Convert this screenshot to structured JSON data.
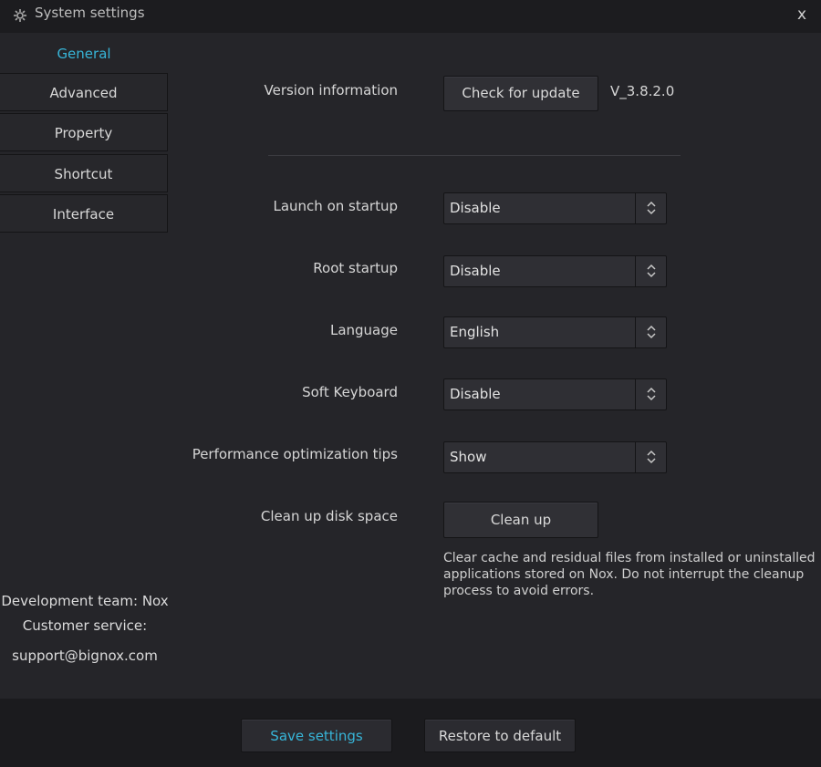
{
  "window": {
    "title": "System settings",
    "close_label": "x"
  },
  "sidebar": {
    "items": [
      {
        "label": "General",
        "active": true
      },
      {
        "label": "Advanced"
      },
      {
        "label": "Property"
      },
      {
        "label": "Shortcut"
      },
      {
        "label": "Interface"
      }
    ],
    "dev_team": "Development team: Nox",
    "customer_service": "Customer service:",
    "support_email": "support@bignox.com"
  },
  "general": {
    "version_label": "Version information",
    "check_update_label": "Check for update",
    "version_value": "V_3.8.2.0",
    "launch_label": "Launch on startup",
    "launch_value": "Disable",
    "root_label": "Root startup",
    "root_value": "Disable",
    "language_label": "Language",
    "language_value": "English",
    "keyboard_label": "Soft Keyboard",
    "keyboard_value": "Disable",
    "perf_label": "Performance optimization tips",
    "perf_value": "Show",
    "cleanup_label": "Clean up disk space",
    "cleanup_button": "Clean up",
    "cleanup_desc": "Clear cache and residual files from installed or uninstalled applications stored on Nox. Do not interrupt the cleanup process to avoid errors."
  },
  "footer": {
    "save_label": "Save settings",
    "restore_label": "Restore to default"
  },
  "colors": {
    "accent": "#37b5d8",
    "background": "#252529",
    "footer": "#1b1b1e"
  },
  "icons": {
    "title": "gear-icon",
    "close": "close-icon",
    "select_arrow": "up-down-chevron-icon"
  }
}
